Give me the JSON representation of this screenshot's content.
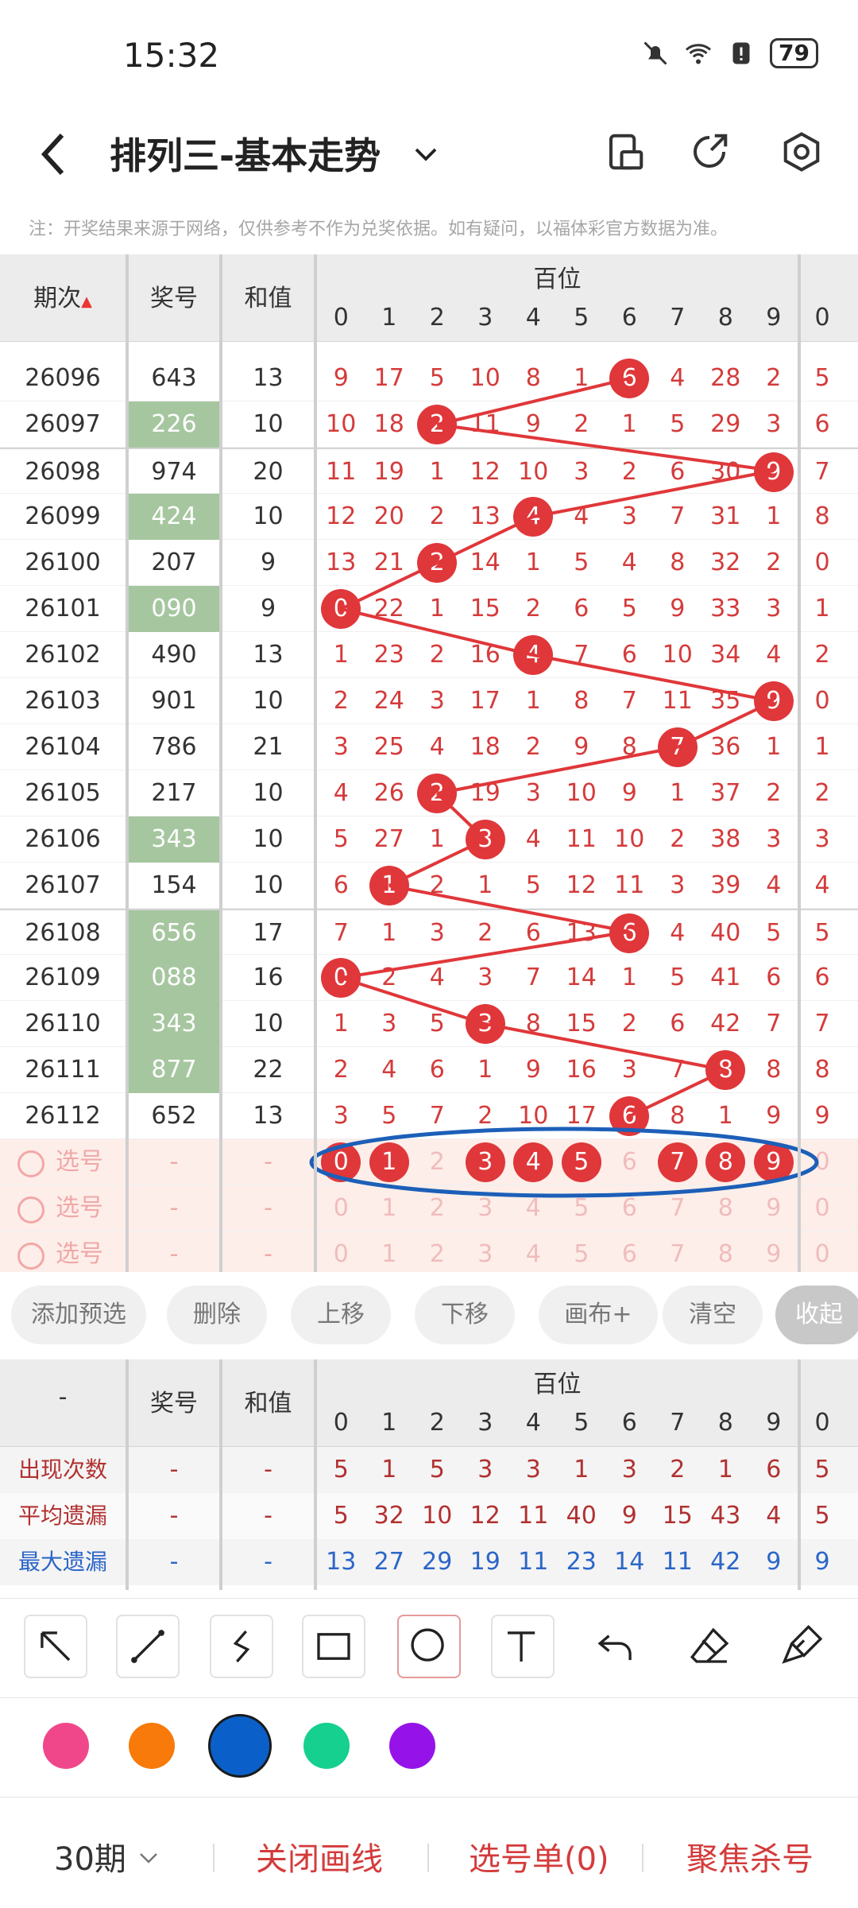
{
  "status": {
    "time": "15:32",
    "battery": "79"
  },
  "header": {
    "title": "排列三-基本走势"
  },
  "notice": "注：开奖结果来源于网络，仅供参考不作为兑奖依据。如有疑问，以福体彩官方数据为准。",
  "columns": {
    "period": "期次",
    "prize": "奖号",
    "sum": "和值",
    "hundreds": "百位",
    "digits": [
      "0",
      "1",
      "2",
      "3",
      "4",
      "5",
      "6",
      "7",
      "8",
      "9"
    ],
    "tens_first": "0"
  },
  "rows": [
    {
      "period": "26096",
      "prize": "643",
      "sum": "13",
      "cells": [
        "9",
        "17",
        "5",
        "10",
        "8",
        "1",
        "6",
        "4",
        "28",
        "2"
      ],
      "next": "5",
      "hit": 6,
      "green": false
    },
    {
      "period": "26097",
      "prize": "226",
      "sum": "10",
      "cells": [
        "10",
        "18",
        "2",
        "11",
        "9",
        "2",
        "1",
        "5",
        "29",
        "3"
      ],
      "next": "6",
      "hit": 2,
      "green": true
    },
    {
      "period": "26098",
      "prize": "974",
      "sum": "20",
      "cells": [
        "11",
        "19",
        "1",
        "12",
        "10",
        "3",
        "2",
        "6",
        "30",
        "9"
      ],
      "next": "7",
      "hit": 9,
      "green": false
    },
    {
      "period": "26099",
      "prize": "424",
      "sum": "10",
      "cells": [
        "12",
        "20",
        "2",
        "13",
        "4",
        "4",
        "3",
        "7",
        "31",
        "1"
      ],
      "next": "8",
      "hit": 4,
      "green": true
    },
    {
      "period": "26100",
      "prize": "207",
      "sum": "9",
      "cells": [
        "13",
        "21",
        "2",
        "14",
        "1",
        "5",
        "4",
        "8",
        "32",
        "2"
      ],
      "next": "0",
      "hit": 2,
      "green": false
    },
    {
      "period": "26101",
      "prize": "090",
      "sum": "9",
      "cells": [
        "0",
        "22",
        "1",
        "15",
        "2",
        "6",
        "5",
        "9",
        "33",
        "3"
      ],
      "next": "1",
      "hit": 0,
      "green": true
    },
    {
      "period": "26102",
      "prize": "490",
      "sum": "13",
      "cells": [
        "1",
        "23",
        "2",
        "16",
        "4",
        "7",
        "6",
        "10",
        "34",
        "4"
      ],
      "next": "2",
      "hit": 4,
      "green": false
    },
    {
      "period": "26103",
      "prize": "901",
      "sum": "10",
      "cells": [
        "2",
        "24",
        "3",
        "17",
        "1",
        "8",
        "7",
        "11",
        "35",
        "9"
      ],
      "next": "0",
      "hit": 9,
      "green": false
    },
    {
      "period": "26104",
      "prize": "786",
      "sum": "21",
      "cells": [
        "3",
        "25",
        "4",
        "18",
        "2",
        "9",
        "8",
        "7",
        "36",
        "1"
      ],
      "next": "1",
      "hit": 7,
      "green": false
    },
    {
      "period": "26105",
      "prize": "217",
      "sum": "10",
      "cells": [
        "4",
        "26",
        "2",
        "19",
        "3",
        "10",
        "9",
        "1",
        "37",
        "2"
      ],
      "next": "2",
      "hit": 2,
      "green": false
    },
    {
      "period": "26106",
      "prize": "343",
      "sum": "10",
      "cells": [
        "5",
        "27",
        "1",
        "3",
        "4",
        "11",
        "10",
        "2",
        "38",
        "3"
      ],
      "next": "3",
      "hit": 3,
      "green": true
    },
    {
      "period": "26107",
      "prize": "154",
      "sum": "10",
      "cells": [
        "6",
        "1",
        "2",
        "1",
        "5",
        "12",
        "11",
        "3",
        "39",
        "4"
      ],
      "next": "4",
      "hit": 1,
      "green": false
    },
    {
      "period": "26108",
      "prize": "656",
      "sum": "17",
      "cells": [
        "7",
        "1",
        "3",
        "2",
        "6",
        "13",
        "6",
        "4",
        "40",
        "5"
      ],
      "next": "5",
      "hit": 6,
      "green": true
    },
    {
      "period": "26109",
      "prize": "088",
      "sum": "16",
      "cells": [
        "0",
        "2",
        "4",
        "3",
        "7",
        "14",
        "1",
        "5",
        "41",
        "6"
      ],
      "next": "6",
      "hit": 0,
      "green": true
    },
    {
      "period": "26110",
      "prize": "343",
      "sum": "10",
      "cells": [
        "1",
        "3",
        "5",
        "3",
        "8",
        "15",
        "2",
        "6",
        "42",
        "7"
      ],
      "next": "7",
      "hit": 3,
      "green": true
    },
    {
      "period": "26111",
      "prize": "877",
      "sum": "22",
      "cells": [
        "2",
        "4",
        "6",
        "1",
        "9",
        "16",
        "3",
        "7",
        "8",
        "8"
      ],
      "next": "8",
      "hit": 8,
      "green": true
    },
    {
      "period": "26112",
      "prize": "652",
      "sum": "13",
      "cells": [
        "3",
        "5",
        "7",
        "2",
        "10",
        "17",
        "6",
        "8",
        "1",
        "9"
      ],
      "next": "9",
      "hit": 6,
      "green": false
    }
  ],
  "select_rows": [
    {
      "label": "选号",
      "dash": "-",
      "balls": [
        0,
        1,
        3,
        4,
        5,
        7,
        8,
        9
      ],
      "digits": [
        "0",
        "1",
        "2",
        "3",
        "4",
        "5",
        "6",
        "7",
        "8",
        "9"
      ]
    },
    {
      "label": "选号",
      "dash": "-",
      "balls": [],
      "digits": [
        "0",
        "1",
        "2",
        "3",
        "4",
        "5",
        "6",
        "7",
        "8",
        "9"
      ]
    },
    {
      "label": "选号",
      "dash": "-",
      "balls": [],
      "digits": [
        "0",
        "1",
        "2",
        "3",
        "4",
        "5",
        "6",
        "7",
        "8",
        "9"
      ]
    }
  ],
  "actions": [
    "添加预选",
    "删除",
    "上移",
    "下移",
    "画布+",
    "清空",
    "收起"
  ],
  "stats": {
    "header_first": "-",
    "rows": [
      {
        "label": "出现次数",
        "color": "#b23131",
        "values": [
          "5",
          "1",
          "5",
          "3",
          "3",
          "1",
          "3",
          "2",
          "1",
          "6"
        ],
        "next": "5"
      },
      {
        "label": "平均遗漏",
        "color": "#b23131",
        "values": [
          "5",
          "32",
          "10",
          "12",
          "11",
          "40",
          "9",
          "15",
          "43",
          "4"
        ],
        "next": "5"
      },
      {
        "label": "最大遗漏",
        "color": "#2c66c8",
        "values": [
          "13",
          "27",
          "29",
          "19",
          "11",
          "23",
          "14",
          "11",
          "42",
          "9"
        ],
        "next": "9"
      }
    ]
  },
  "palette": [
    "#f0478a",
    "#f77a0a",
    "#0a60c8",
    "#16d08f",
    "#9513e8"
  ],
  "bottom": {
    "periods": "30期",
    "close_draw": "关闭画线",
    "select_list": "选号单(0)",
    "focus_kill": "聚焦杀号"
  }
}
